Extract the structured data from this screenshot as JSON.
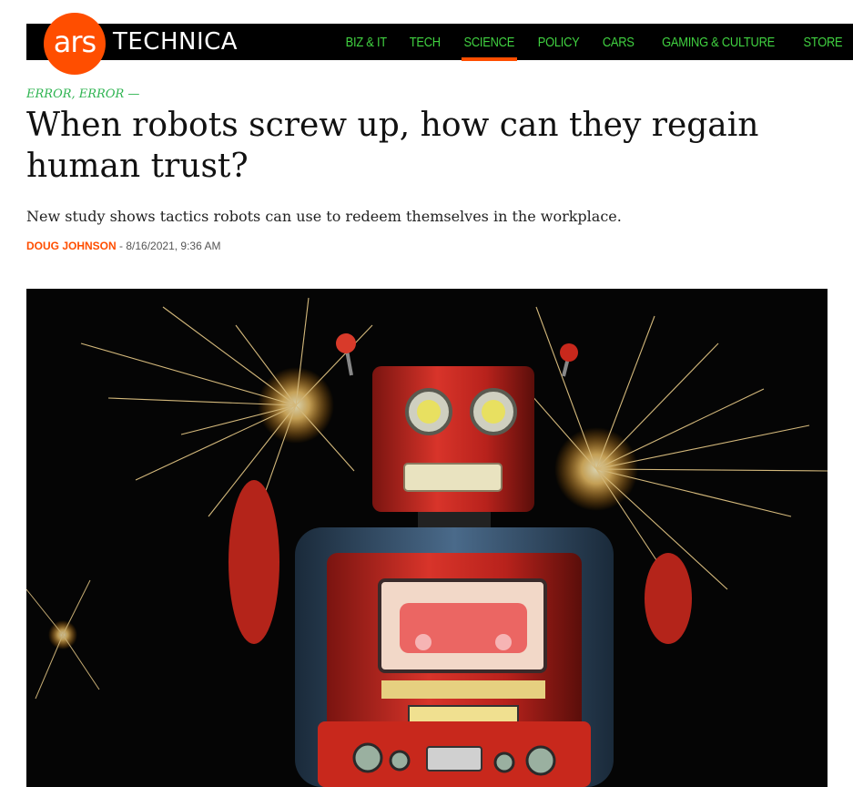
{
  "site": {
    "logo_mark": "ars",
    "logo_word": "TECHNICA",
    "brand_color": "#ff4e00",
    "nav_color": "#40d040",
    "nav": [
      {
        "label": "BIZ & IT",
        "active": false
      },
      {
        "label": "TECH",
        "active": false
      },
      {
        "label": "SCIENCE",
        "active": true
      },
      {
        "label": "POLICY",
        "active": false
      },
      {
        "label": "CARS",
        "active": false
      },
      {
        "label": "GAMING & CULTURE",
        "active": false
      },
      {
        "label": "STORE",
        "active": false
      }
    ]
  },
  "article": {
    "kicker": "ERROR, ERROR —",
    "title": "When robots screw up, how can they regain human trust?",
    "dek": "New study shows tactics robots can use to redeem themselves in the workplace.",
    "author": "DOUG JOHNSON",
    "date": "- 8/16/2021, 9:36 AM"
  },
  "hero_image": {
    "subject": "red tin toy robot with sparklers"
  }
}
